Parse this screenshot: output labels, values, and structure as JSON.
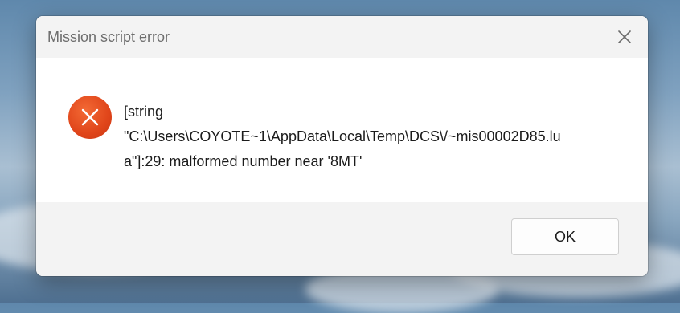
{
  "dialog": {
    "title": "Mission script error",
    "close_icon": "close-icon",
    "error_icon": "error-x-icon",
    "message": "[string\n\"C:\\Users\\COYOTE~1\\AppData\\Local\\Temp\\DCS\\/~mis00002D85.lu\na\"]:29: malformed number near '8MT'",
    "ok_label": "OK"
  },
  "colors": {
    "error_accent": "#e0451a",
    "dialog_background": "#ffffff",
    "bar_background": "#f3f3f3"
  }
}
